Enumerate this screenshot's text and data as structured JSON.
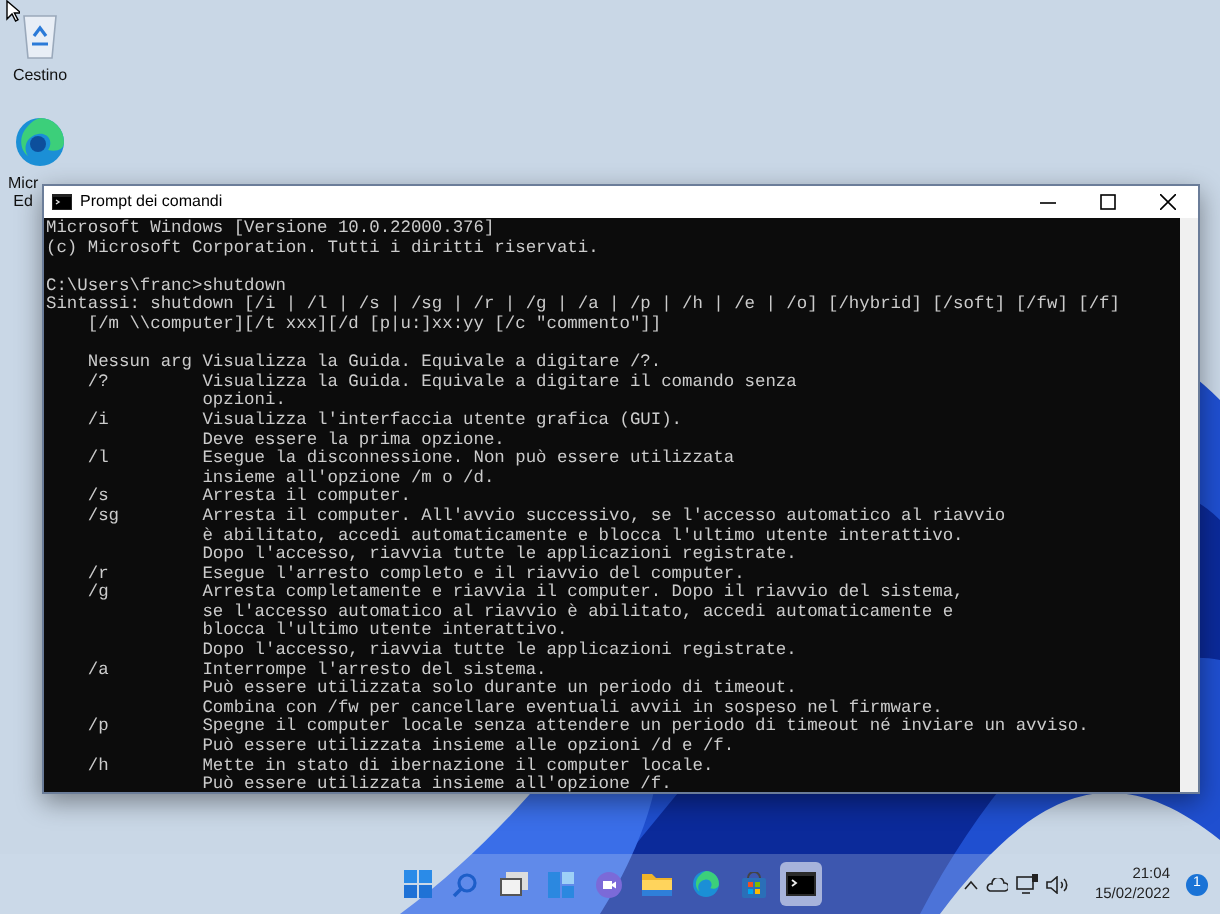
{
  "desktop_icons": [
    {
      "kind": "recycle-bin",
      "label_lines": [
        "Cestino"
      ]
    },
    {
      "kind": "edge",
      "label_lines": [
        "Micr",
        "Ed"
      ]
    }
  ],
  "window": {
    "title": "Prompt dei comandi",
    "console_blocks": [
      [
        "Microsoft Windows [Versione 10.0.22000.376]",
        "(c) Microsoft Corporation. Tutti i diritti riservati."
      ],
      [
        "C:\\Users\\franc>shutdown",
        "Sintassi: shutdown [/i | /l | /s | /sg | /r | /g | /a | /p | /h | /e | /o] [/hybrid] [/soft] [/fw] [/f]",
        "    [/m \\\\computer][/t xxx][/d [p|u:]xx:yy [/c \"commento\"]]"
      ],
      [
        "    Nessun arg Visualizza la Guida. Equivale a digitare /?.",
        "    /?         Visualizza la Guida. Equivale a digitare il comando senza",
        "               opzioni.",
        "    /i         Visualizza l'interfaccia utente grafica (GUI).",
        "               Deve essere la prima opzione.",
        "    /l         Esegue la disconnessione. Non può essere utilizzata",
        "               insieme all'opzione /m o /d.",
        "    /s         Arresta il computer.",
        "    /sg        Arresta il computer. All'avvio successivo, se l'accesso automatico al riavvio",
        "               è abilitato, accedi automaticamente e blocca l'ultimo utente interattivo.",
        "               Dopo l'accesso, riavvia tutte le applicazioni registrate.",
        "    /r         Esegue l'arresto completo e il riavvio del computer.",
        "    /g         Arresta completamente e riavvia il computer. Dopo il riavvio del sistema,",
        "               se l'accesso automatico al riavvio è abilitato, accedi automaticamente e",
        "               blocca l'ultimo utente interattivo.",
        "               Dopo l'accesso, riavvia tutte le applicazioni registrate.",
        "    /a         Interrompe l'arresto del sistema.",
        "               Può essere utilizzata solo durante un periodo di timeout.",
        "               Combina con /fw per cancellare eventuali avvii in sospeso nel firmware.",
        "    /p         Spegne il computer locale senza attendere un periodo di timeout né inviare un avviso.",
        "               Può essere utilizzata insieme alle opzioni /d e /f.",
        "    /h         Mette in stato di ibernazione il computer locale.",
        "               Può essere utilizzata insieme all'opzione /f."
      ]
    ]
  },
  "taskbar": {
    "apps": [
      {
        "kind": "start",
        "selected": false
      },
      {
        "kind": "search",
        "selected": false
      },
      {
        "kind": "task-view",
        "selected": false
      },
      {
        "kind": "widgets",
        "selected": false
      },
      {
        "kind": "chat",
        "selected": false
      },
      {
        "kind": "explorer",
        "selected": false
      },
      {
        "kind": "edge",
        "selected": false
      },
      {
        "kind": "store",
        "selected": false
      },
      {
        "kind": "terminal",
        "selected": true
      }
    ],
    "tray": {
      "time": "21:04",
      "date": "15/02/2022",
      "notifications": "1"
    }
  }
}
